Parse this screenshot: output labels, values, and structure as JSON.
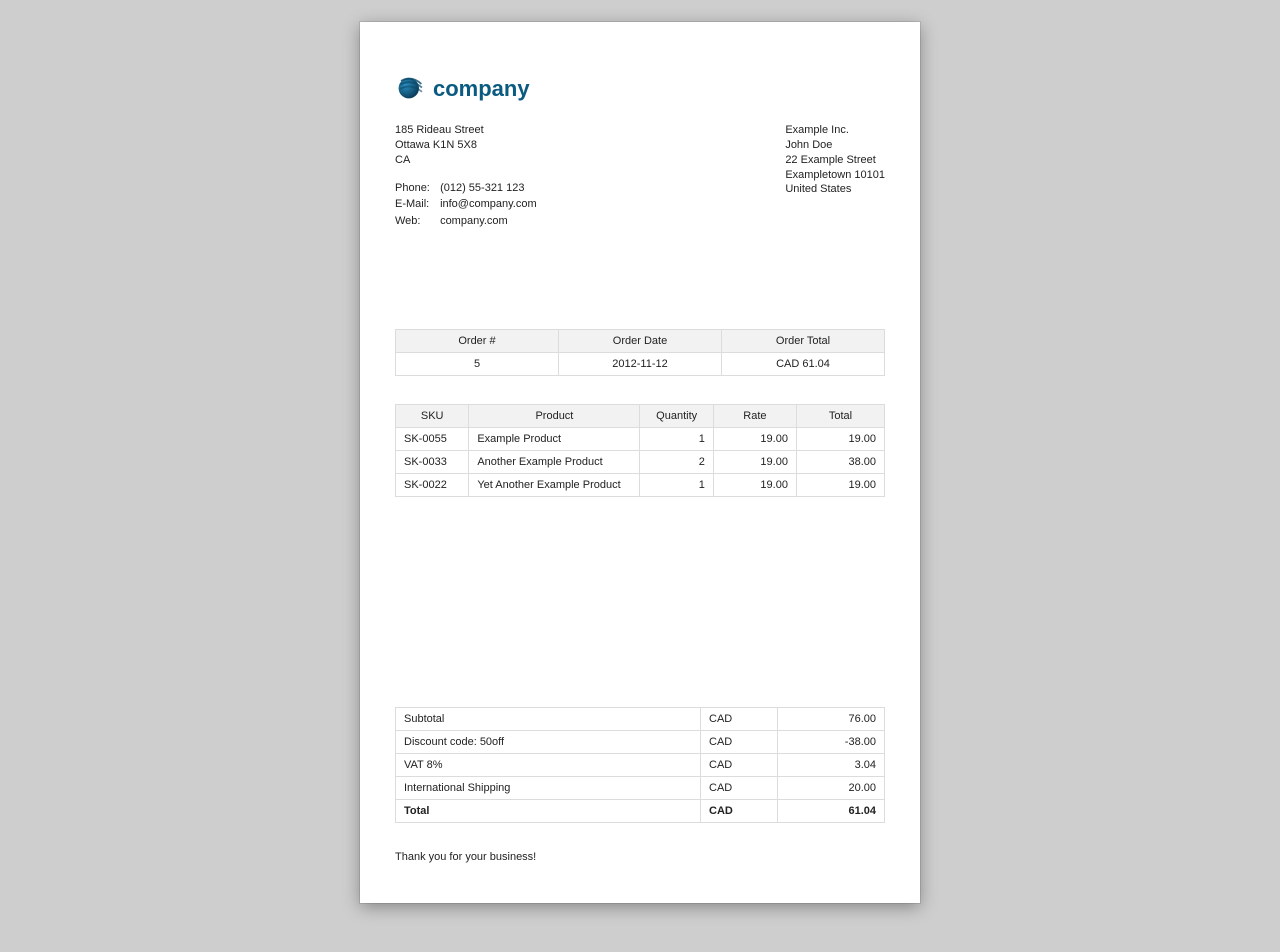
{
  "company_word": "company",
  "company": {
    "address_1": "185 Rideau Street",
    "address_2": "Ottawa K1N 5X8",
    "country": "CA",
    "phone_label": "Phone:",
    "phone": "(012) 55-321 123",
    "email_label": "E-Mail:",
    "email": "info@company.com",
    "web_label": "Web:",
    "web": "company.com"
  },
  "customer": {
    "company": "Example Inc.",
    "name": "John Doe",
    "street": "22 Example Street",
    "city": "Exampletown 10101",
    "country": "United States"
  },
  "order_summary": {
    "h_number": "Order #",
    "h_date": "Order Date",
    "h_total": "Order Total",
    "number": "5",
    "date": "2012-11-12",
    "total": "CAD 61.04"
  },
  "items_header": {
    "sku": "SKU",
    "product": "Product",
    "qty": "Quantity",
    "rate": "Rate",
    "total": "Total"
  },
  "items": [
    {
      "sku": "SK-0055",
      "product": "Example Product",
      "qty": "1",
      "rate": "19.00",
      "total": "19.00"
    },
    {
      "sku": "SK-0033",
      "product": "Another Example Product",
      "qty": "2",
      "rate": "19.00",
      "total": "38.00"
    },
    {
      "sku": "SK-0022",
      "product": "Yet Another Example Product",
      "qty": "1",
      "rate": "19.00",
      "total": "19.00"
    }
  ],
  "totals": [
    {
      "label": "Subtotal",
      "cur": "CAD",
      "amt": "76.00"
    },
    {
      "label": "Discount code: 50off",
      "cur": "CAD",
      "amt": "-38.00"
    },
    {
      "label": "VAT 8%",
      "cur": "CAD",
      "amt": "3.04"
    },
    {
      "label": "International Shipping",
      "cur": "CAD",
      "amt": "20.00"
    }
  ],
  "grand_total": {
    "label": "Total",
    "cur": "CAD",
    "amt": "61.04"
  },
  "thanks": "Thank you for your business!"
}
